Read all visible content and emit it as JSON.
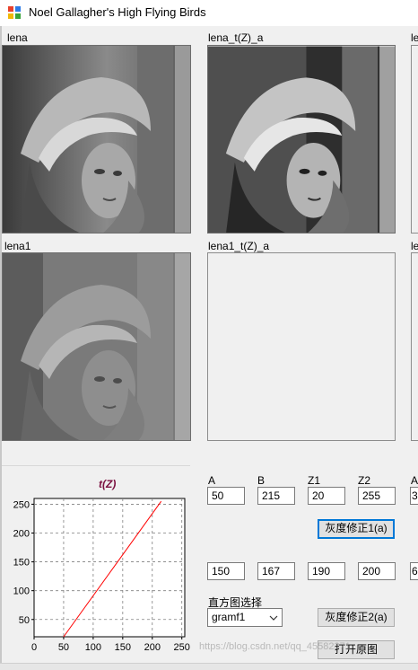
{
  "window": {
    "title": "Noel Gallagher's High Flying Birds"
  },
  "images": {
    "lena": "lena",
    "lena_t": "lena_t(Z)_a",
    "col3_top": "le",
    "lena1": "lena1",
    "lena1_t": "lena1_t(Z)_a",
    "col3_bottom": "le"
  },
  "params": {
    "headers": [
      "A",
      "B",
      "Z1",
      "Z2",
      "A"
    ],
    "row1": [
      "50",
      "215",
      "20",
      "255",
      "3"
    ],
    "row2": [
      "150",
      "167",
      "190",
      "200",
      "6"
    ]
  },
  "buttons": {
    "gray_correct_1": "灰度修正1(a)",
    "gray_correct_2": "灰度修正2(a)",
    "open_image": "打开原图"
  },
  "histogram": {
    "label": "直方图选择",
    "selected": "gramf1"
  },
  "watermark": "https://blog.csdn.net/qq_45582371",
  "chart_data": {
    "type": "line",
    "title": "t(Z)",
    "xlabel": "",
    "ylabel": "",
    "xlim": [
      0,
      255
    ],
    "ylim": [
      20,
      260
    ],
    "x_ticks": [
      "0",
      "50",
      "100",
      "150",
      "200",
      "250"
    ],
    "y_ticks": [
      "50",
      "100",
      "150",
      "200",
      "250"
    ],
    "grid": true,
    "series": [
      {
        "x": [
          50,
          215
        ],
        "y": [
          20,
          255
        ],
        "color": "#ff0000"
      }
    ],
    "title_color": "#7b1040"
  }
}
